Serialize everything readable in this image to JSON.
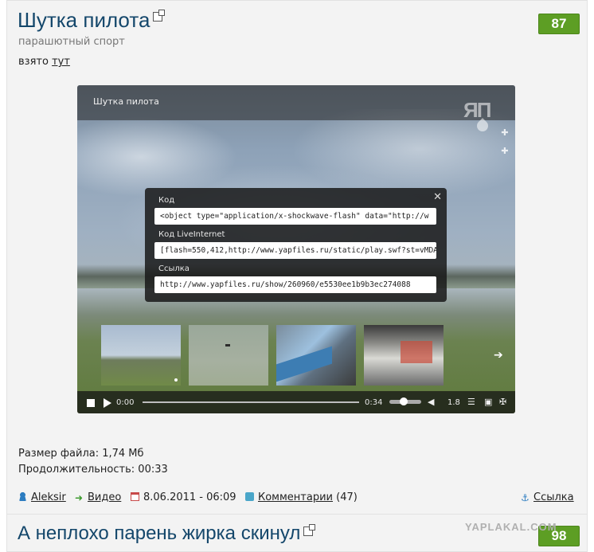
{
  "post": {
    "title": "Шутка пилота",
    "rating": "87",
    "category": "парашютный спорт",
    "source_prefix": "взято",
    "source_link": "тут",
    "player": {
      "title": "Шутка пилота",
      "logo": "ЯП",
      "embed": {
        "code_label": "Код",
        "code_value": "<object type=\"application/x-shockwave-flash\" data=\"http://w",
        "liveinternet_label": "Код LiveInternet",
        "liveinternet_value": "[flash=550,412,http://www.yapfiles.ru/static/play.swf?st=vMDA",
        "link_label": "Ссылка",
        "link_value": "http://www.yapfiles.ru/show/260960/e5530ee1b9b3ec274088"
      },
      "controls": {
        "current_time": "0:00",
        "duration": "0:34",
        "speed": "1.8",
        "progress_fraction": 0,
        "volume_fraction": 0.45
      }
    },
    "file_size_label": "Размер файла:",
    "file_size": "1,74 Мб",
    "duration_label": "Продолжительность:",
    "duration": "00:33",
    "footer": {
      "author": "Aleksir",
      "section": "Видео",
      "date": "8.06.2011 - 06:09",
      "comments_label": "Комментарии",
      "comments_count": "(47)",
      "link_label": "Ссылка"
    }
  },
  "next_post": {
    "title": "А неплохо парень жирка скинул",
    "rating": "98"
  },
  "watermark": "YAPLAKAL.COM",
  "colors": {
    "title": "#14476b",
    "rating_bg": "#5d9e24",
    "post_bg": "#f3f3f3"
  }
}
